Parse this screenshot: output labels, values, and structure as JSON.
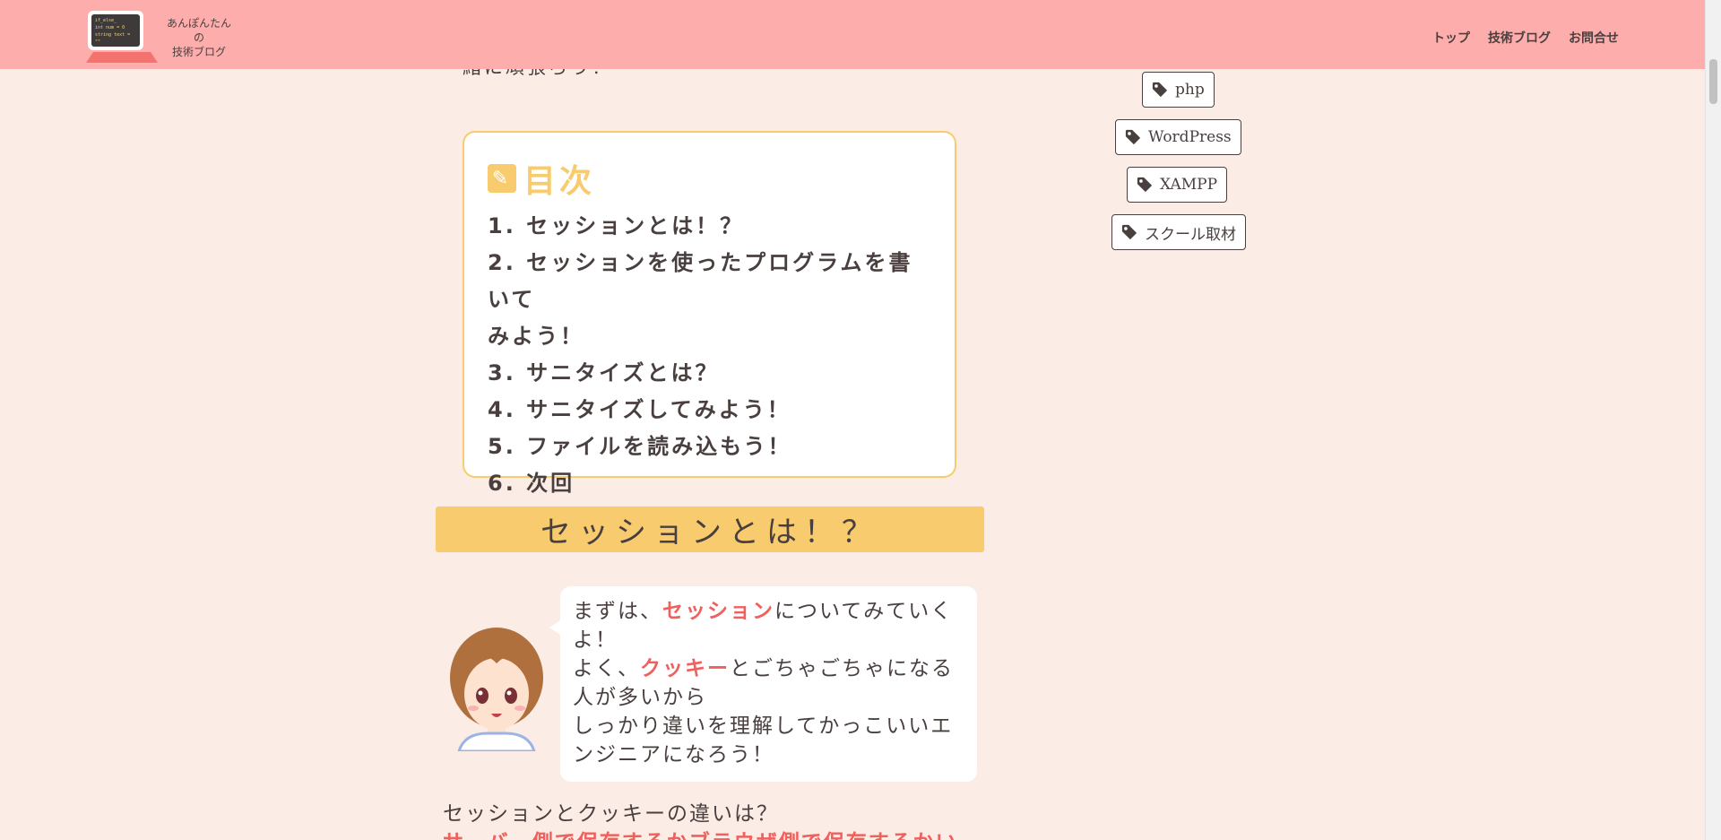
{
  "header": {
    "site_title_line1": "あんぽんたん",
    "site_title_line2": "の",
    "site_title_line3": "技術ブログ",
    "logo_code_line1": "if_else_",
    "logo_code_line2": "int num = 0",
    "logo_code_line3": "string text = \"\"",
    "nav": [
      {
        "label": "トップ"
      },
      {
        "label": "技術ブログ"
      },
      {
        "label": "お問合せ"
      }
    ]
  },
  "article": {
    "cut_text": "緒に頑張ろう！",
    "toc": {
      "title": "目次",
      "items": [
        {
          "label": "1. セッションとは！？"
        },
        {
          "label": "2. セッションを使ったプログラムを書いて"
        },
        {
          "label": "みよう！"
        },
        {
          "label": "3. サニタイズとは？"
        },
        {
          "label": "4. サニタイズしてみよう！"
        },
        {
          "label": "5. ファイルを読み込もう！"
        },
        {
          "label": "6. 次回"
        }
      ]
    },
    "section_heading": "セッションとは！？",
    "bubble": {
      "p1_pre": "まずは、",
      "p1_hl": "セッション",
      "p1_post": "についてみていくよ！",
      "p2_pre": "よく、",
      "p2_hl": "クッキー",
      "p2_post": "とごちゃごちゃになる人が多いから",
      "p3": "しっかり違いを理解してかっこいいエンジニアになろう！"
    },
    "body_text": "セッションとクッキーの違いは？",
    "body_text2": "サーバー側で保存するかブラウザ側で保存するかい"
  },
  "sidebar": {
    "tags": [
      {
        "label": "php"
      },
      {
        "label": "WordPress"
      },
      {
        "label": "XAMPP"
      },
      {
        "label": "スクール取材"
      }
    ]
  },
  "colors": {
    "header_bg": "#fdadab",
    "page_bg": "#fbede6",
    "accent_yellow": "#f7cb6e",
    "highlight_red": "#f0605d",
    "text": "#4a3f3f"
  }
}
